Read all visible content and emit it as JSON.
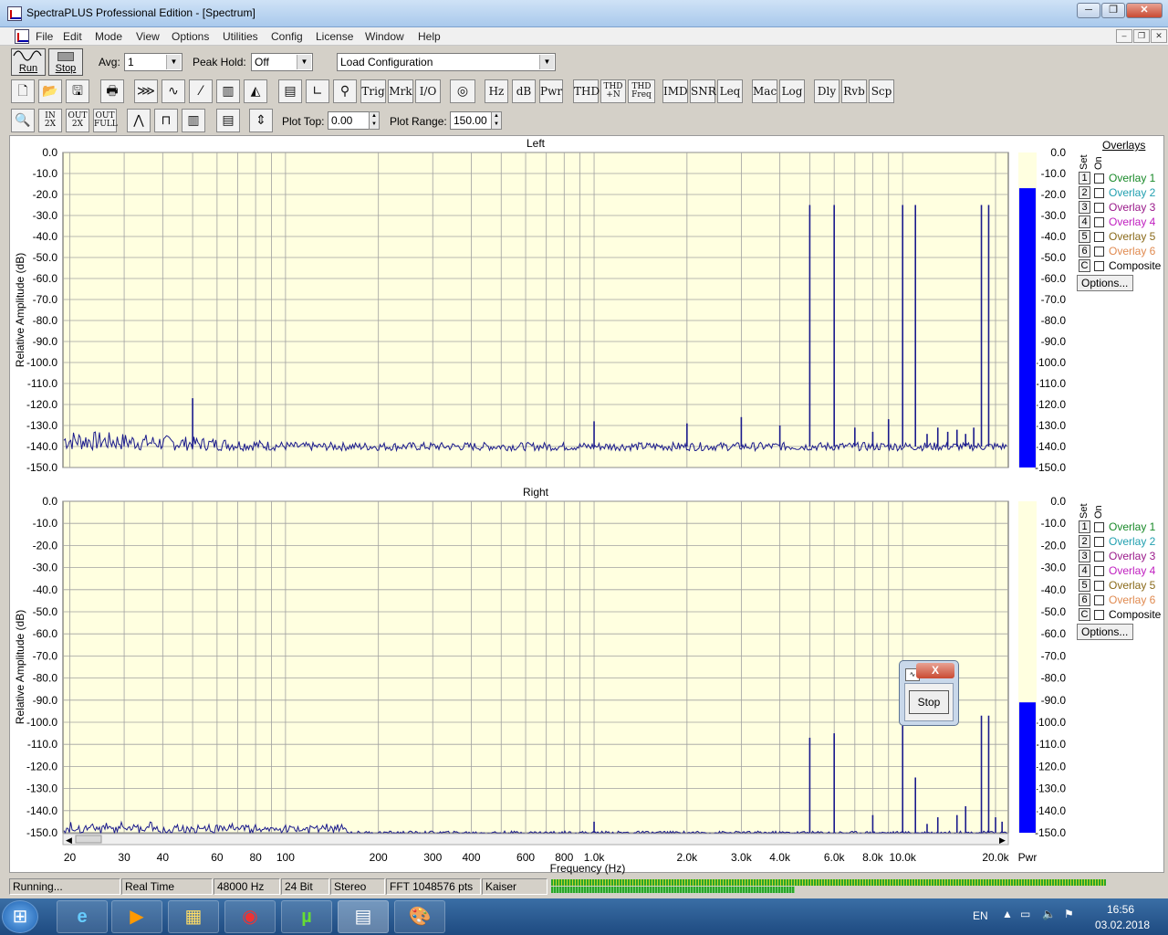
{
  "window": {
    "title": "SpectraPLUS Professional Edition - [Spectrum]",
    "min_glyph": "─",
    "max_glyph": "❐",
    "close_glyph": "✕"
  },
  "menu": [
    "File",
    "Edit",
    "Mode",
    "View",
    "Options",
    "Utilities",
    "Config",
    "License",
    "Window",
    "Help"
  ],
  "mdi": {
    "min_glyph": "–",
    "restore_glyph": "❐",
    "close_glyph": "✕"
  },
  "toolbar1": {
    "run_label": "Run",
    "stop_label": "Stop",
    "avg_label": "Avg:",
    "avg_value": "1",
    "peak_hold_label": "Peak Hold:",
    "peak_hold_value": "Off",
    "config_value": "Load Configuration",
    "combo_arrow": "▼"
  },
  "toolbar2": [
    {
      "name": "new-file",
      "text": "🗋"
    },
    {
      "name": "open-file",
      "text": "📂"
    },
    {
      "name": "save-file",
      "text": "🖫"
    },
    {
      "name": "print",
      "text": "🖶"
    },
    {
      "name": "fast-forward",
      "text": "⋙"
    },
    {
      "name": "scope-view",
      "text": "∿"
    },
    {
      "name": "ramp-view",
      "text": "⁄"
    },
    {
      "name": "spectrogram",
      "text": "▥"
    },
    {
      "name": "3d-surface",
      "text": "◭"
    },
    {
      "name": "panel-view",
      "text": "▤"
    },
    {
      "name": "scale-view",
      "text": "∟"
    },
    {
      "name": "cursor-tool",
      "text": "⚲"
    },
    {
      "name": "trig",
      "text": "Trig"
    },
    {
      "name": "mrk",
      "text": "Mrk"
    },
    {
      "name": "io",
      "text": "I/O"
    },
    {
      "name": "signal-gen",
      "text": "◎"
    },
    {
      "name": "hz",
      "text": "Hz"
    },
    {
      "name": "db",
      "text": "dB"
    },
    {
      "name": "pwr",
      "text": "Pwr"
    },
    {
      "name": "thd",
      "text": "THD"
    },
    {
      "name": "thd-n",
      "text": "THD +N"
    },
    {
      "name": "thd-freq",
      "text": "THD Freq"
    },
    {
      "name": "imd",
      "text": "IMD"
    },
    {
      "name": "snr",
      "text": "SNR"
    },
    {
      "name": "leq",
      "text": "Leq"
    },
    {
      "name": "mac",
      "text": "Mac"
    },
    {
      "name": "log",
      "text": "Log"
    },
    {
      "name": "dly",
      "text": "Dly"
    },
    {
      "name": "rvb",
      "text": "Rvb"
    },
    {
      "name": "scp",
      "text": "Scp"
    }
  ],
  "toolbar3": {
    "buttons": [
      {
        "name": "zoom",
        "text": "🔍"
      },
      {
        "name": "zoom-in-2x",
        "text": "IN 2X"
      },
      {
        "name": "zoom-out-2x",
        "text": "OUT 2X"
      },
      {
        "name": "zoom-out-full",
        "text": "OUT FULL"
      },
      {
        "name": "line-plot",
        "text": "⋀"
      },
      {
        "name": "step-plot",
        "text": "⊓"
      },
      {
        "name": "bar-plot",
        "text": "▥"
      },
      {
        "name": "table-view",
        "text": "▤"
      },
      {
        "name": "range-tool",
        "text": "⇕"
      }
    ],
    "plot_top_label": "Plot Top:",
    "plot_top_value": "0.00",
    "plot_range_label": "Plot Range:",
    "plot_range_value": "150.00",
    "spin_up": "▲",
    "spin_down": "▼"
  },
  "chart_data": [
    {
      "type": "line",
      "title": "Left",
      "xlabel": "Frequency (Hz)",
      "ylabel": "Relative Amplitude (dB)",
      "x_scale": "log",
      "xlim": [
        19,
        22000
      ],
      "ylim": [
        -150,
        0
      ],
      "grid": true,
      "yticks": [
        "0.0",
        "-10.0",
        "-20.0",
        "-30.0",
        "-40.0",
        "-50.0",
        "-60.0",
        "-70.0",
        "-80.0",
        "-90.0",
        "-100.0",
        "-110.0",
        "-120.0",
        "-130.0",
        "-140.0",
        "-150.0"
      ],
      "noise_floor_db": -140,
      "peaks": [
        {
          "x": 50,
          "y": -117
        },
        {
          "x": 1000,
          "y": -128
        },
        {
          "x": 2000,
          "y": -129
        },
        {
          "x": 3000,
          "y": -126
        },
        {
          "x": 4000,
          "y": -130
        },
        {
          "x": 5000,
          "y": -25
        },
        {
          "x": 6000,
          "y": -25
        },
        {
          "x": 7000,
          "y": -131
        },
        {
          "x": 8000,
          "y": -133
        },
        {
          "x": 9000,
          "y": -127
        },
        {
          "x": 10000,
          "y": -25
        },
        {
          "x": 11000,
          "y": -25
        },
        {
          "x": 12000,
          "y": -134
        },
        {
          "x": 13000,
          "y": -131
        },
        {
          "x": 14000,
          "y": -133
        },
        {
          "x": 15000,
          "y": -132
        },
        {
          "x": 16000,
          "y": -134
        },
        {
          "x": 17000,
          "y": -131
        },
        {
          "x": 18000,
          "y": -25
        },
        {
          "x": 19000,
          "y": -25
        }
      ],
      "level_meter": {
        "label": "Pwr",
        "value_db": -17
      }
    },
    {
      "type": "line",
      "title": "Right",
      "xlabel": "Frequency (Hz)",
      "ylabel": "Relative Amplitude (dB)",
      "x_scale": "log",
      "xlim": [
        19,
        22000
      ],
      "ylim": [
        -150,
        0
      ],
      "grid": true,
      "yticks": [
        "0.0",
        "-10.0",
        "-20.0",
        "-30.0",
        "-40.0",
        "-50.0",
        "-60.0",
        "-70.0",
        "-80.0",
        "-90.0",
        "-100.0",
        "-110.0",
        "-120.0",
        "-130.0",
        "-140.0",
        "-150.0"
      ],
      "noise_floor_db": -150,
      "peaks": [
        {
          "x": 1000,
          "y": -145
        },
        {
          "x": 5000,
          "y": -107
        },
        {
          "x": 6000,
          "y": -105
        },
        {
          "x": 8000,
          "y": -142
        },
        {
          "x": 10000,
          "y": -90
        },
        {
          "x": 11000,
          "y": -125
        },
        {
          "x": 12000,
          "y": -146
        },
        {
          "x": 13000,
          "y": -143
        },
        {
          "x": 15000,
          "y": -142
        },
        {
          "x": 16000,
          "y": -138
        },
        {
          "x": 18000,
          "y": -97
        },
        {
          "x": 19000,
          "y": -97
        },
        {
          "x": 20000,
          "y": -143
        },
        {
          "x": 21000,
          "y": -145
        }
      ],
      "level_meter": {
        "label": "Pwr",
        "value_db": -91
      }
    }
  ],
  "x_ticks": [
    "20",
    "30",
    "40",
    "60",
    "80",
    "100",
    "200",
    "300",
    "400",
    "600",
    "800",
    "1.0k",
    "2.0k",
    "3.0k",
    "4.0k",
    "6.0k",
    "8.0k",
    "10.0k",
    "20.0k"
  ],
  "x_tick_values": [
    20,
    30,
    40,
    60,
    80,
    100,
    200,
    300,
    400,
    600,
    800,
    1000,
    2000,
    3000,
    4000,
    6000,
    8000,
    10000,
    20000
  ],
  "meter_label": "Pwr",
  "overlays": {
    "heading": "Overlays",
    "set_label": "Set",
    "on_label": "On",
    "items": [
      {
        "set": "1",
        "label": "Overlay 1",
        "color": "#1a8a2a"
      },
      {
        "set": "2",
        "label": "Overlay 2",
        "color": "#22a0b0"
      },
      {
        "set": "3",
        "label": "Overlay 3",
        "color": "#9a1a8a"
      },
      {
        "set": "4",
        "label": "Overlay 4",
        "color": "#c020c0"
      },
      {
        "set": "5",
        "label": "Overlay 5",
        "color": "#8a6a1a"
      },
      {
        "set": "6",
        "label": "Overlay 6",
        "color": "#e08a50"
      },
      {
        "set": "C",
        "label": "Composite",
        "color": "#000000"
      }
    ],
    "options_label": "Options..."
  },
  "dialog": {
    "stop_label": "Stop",
    "close_glyph": "X",
    "icon_glyph": "∿"
  },
  "status": {
    "state": "Running...",
    "mode": "Real Time",
    "sample_rate": "48000 Hz",
    "bits": "24 Bit",
    "channels": "Stereo",
    "fft": "FFT 1048576 pts",
    "window": "Kaiser",
    "progress_top": 0.98,
    "progress_bottom": 0.43
  },
  "taskbar": {
    "apps": [
      {
        "name": "start",
        "glyph": "⊞"
      },
      {
        "name": "internet-explorer",
        "glyph": "e"
      },
      {
        "name": "media-player",
        "glyph": "▶"
      },
      {
        "name": "file-explorer",
        "glyph": "▦"
      },
      {
        "name": "chrome",
        "glyph": "◉"
      },
      {
        "name": "utorrent",
        "glyph": "µ"
      },
      {
        "name": "spectraplus",
        "glyph": "▤"
      },
      {
        "name": "paint",
        "glyph": "🎨"
      }
    ],
    "language": "EN",
    "time": "16:56",
    "date": "03.02.2018",
    "colors": {
      "plot_bg": "#ffffe0",
      "trace": "#1a1a8c",
      "meter": "#0000ff",
      "grid": "#a0a0a0"
    }
  }
}
